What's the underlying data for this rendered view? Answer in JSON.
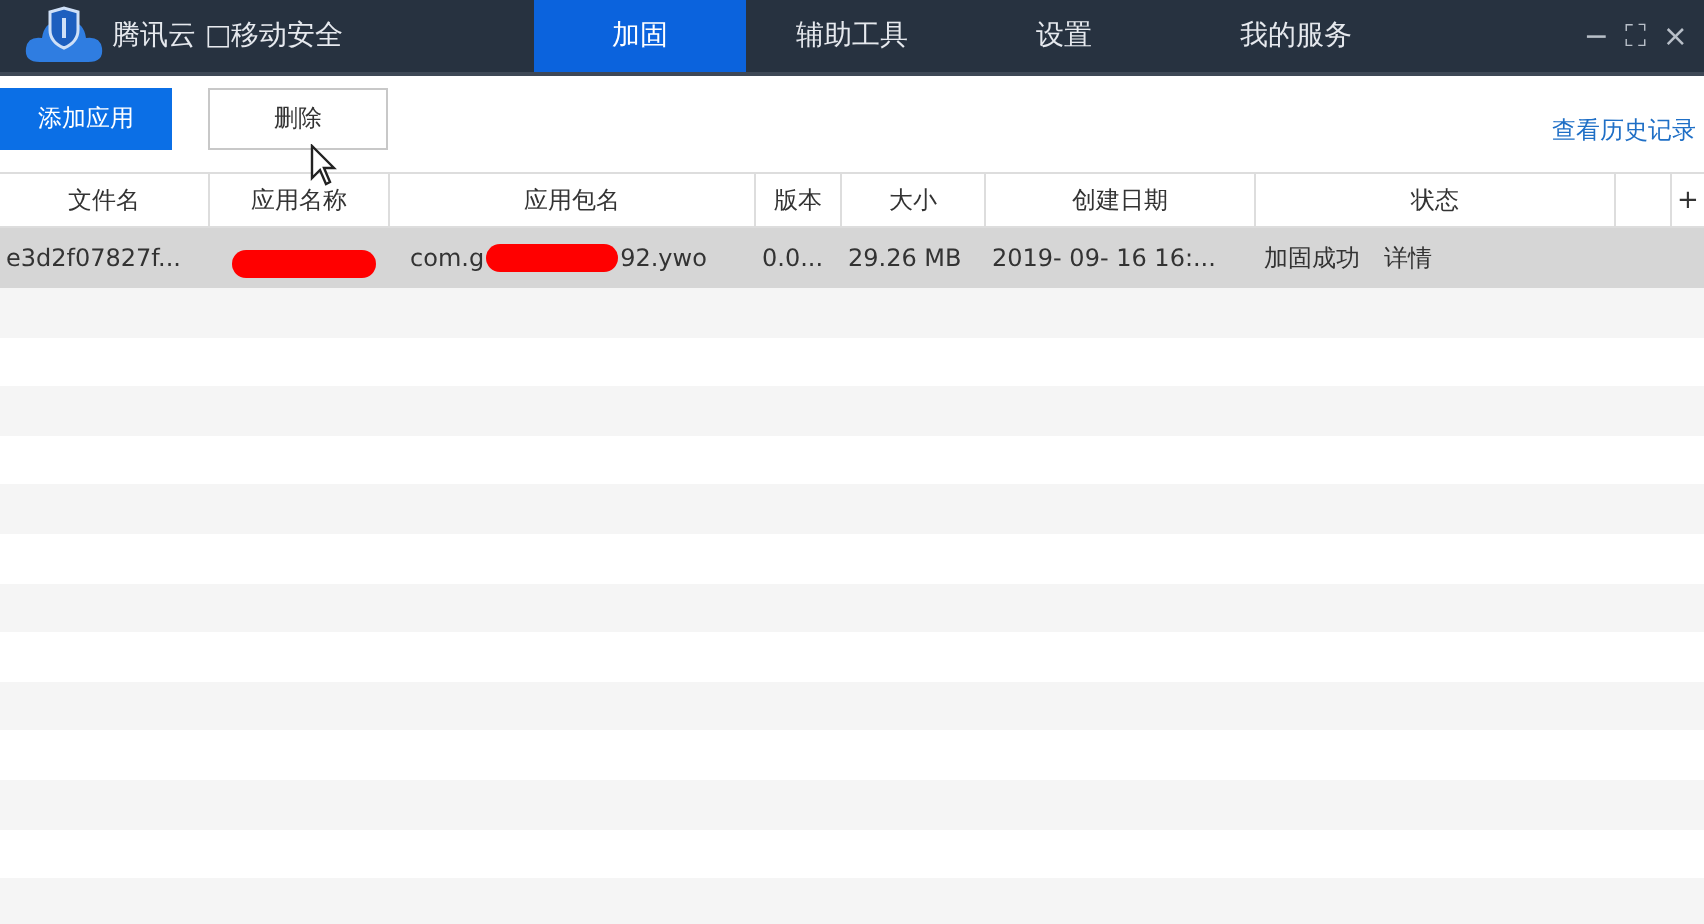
{
  "window": {
    "title": "腾讯云 □移动安全",
    "controls": [
      "−",
      "⛶",
      "×"
    ]
  },
  "tabs": [
    {
      "label": "加固",
      "selected": true
    },
    {
      "label": "辅助工具",
      "selected": false
    },
    {
      "label": "设置",
      "selected": false
    },
    {
      "label": "我的服务",
      "selected": false
    }
  ],
  "toolbar": {
    "buttons": [
      {
        "label": "添加应用",
        "kind": "primary"
      },
      {
        "label": "删除",
        "kind": "plain"
      }
    ],
    "history_link": "查看历史记录"
  },
  "table": {
    "columns": [
      "文件名",
      "应用名称",
      "应用包名",
      "版本",
      "大小",
      "创建日期",
      "状态"
    ],
    "add_column": "+",
    "rows": [
      {
        "selected": true,
        "file": "e3d2f07827f...",
        "app_name_redacted": true,
        "package_start": "com.g",
        "package_end": "92.ywo",
        "version": "0.0...",
        "size": "29.26 MB",
        "date": "2019- 09- 16 16:...",
        "status": "加固成功",
        "details": "详情"
      }
    ]
  }
}
